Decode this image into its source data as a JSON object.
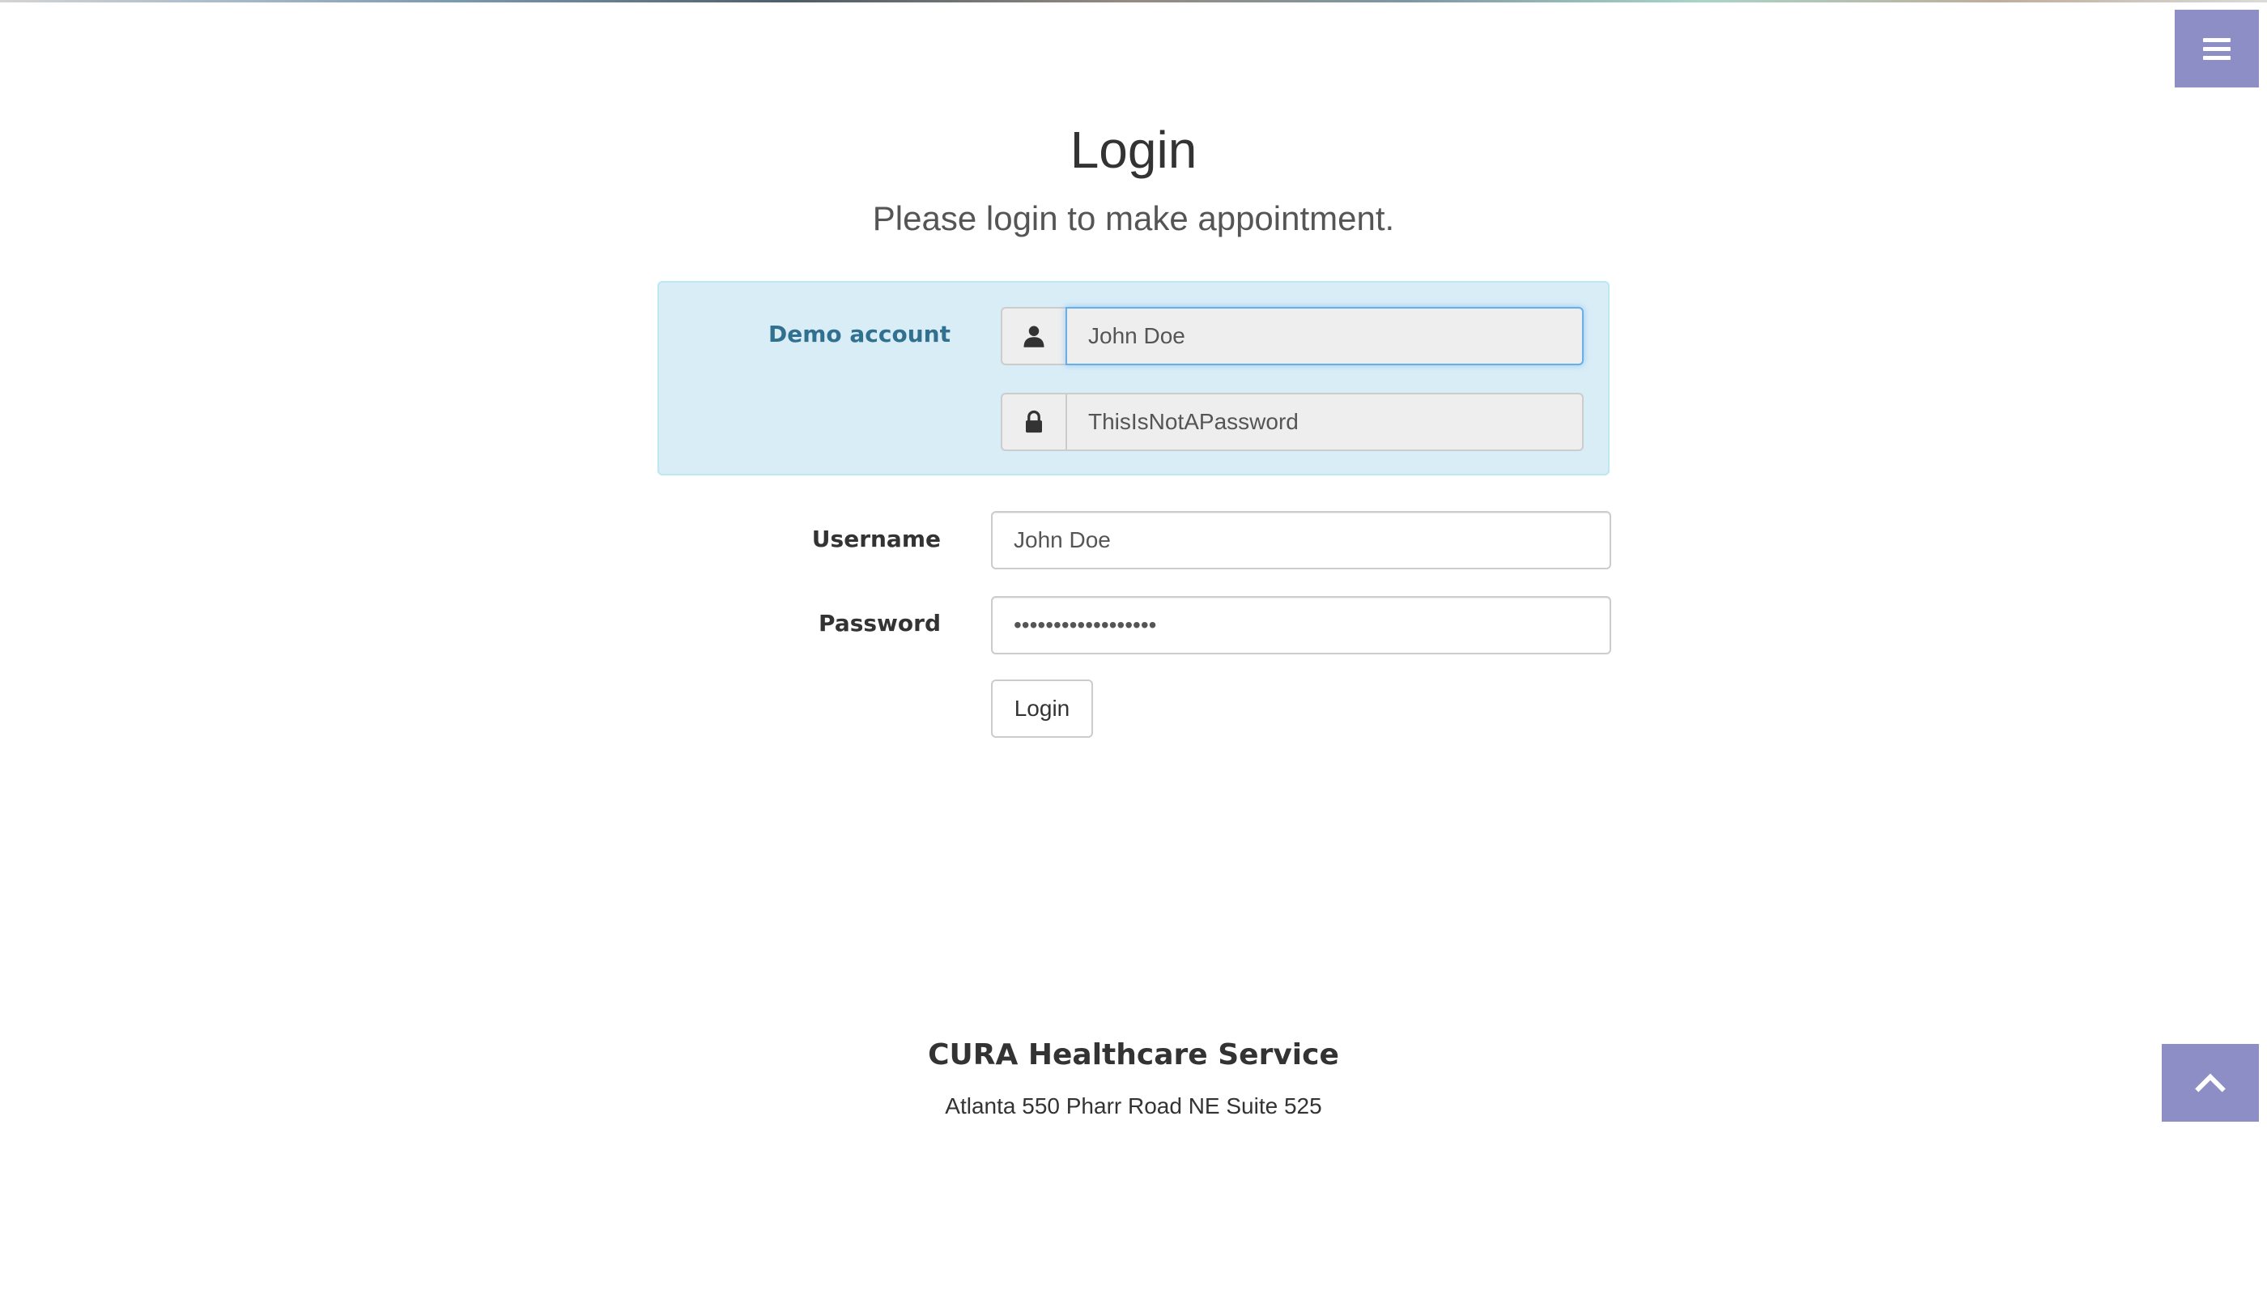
{
  "header": {
    "title": "Login",
    "subtitle": "Please login to make appointment."
  },
  "demo_account": {
    "label": "Demo account",
    "username_value": "John Doe",
    "password_value": "ThisIsNotAPassword",
    "user_icon": "user-icon",
    "lock_icon": "lock-icon"
  },
  "form": {
    "username_label": "Username",
    "username_value": "John Doe",
    "password_label": "Password",
    "password_value": "ThisIsNotAPassword",
    "login_button": "Login"
  },
  "footer": {
    "title": "CURA Healthcare Service",
    "address": "Atlanta 550 Pharr Road NE Suite 525"
  },
  "icons": {
    "menu": "hamburger-menu-icon",
    "scroll_top": "chevron-up-icon"
  },
  "colors": {
    "accent": "#8e8ec7",
    "demo_bg": "#d9edf7",
    "demo_border": "#bce8f1",
    "demo_label": "#31708f",
    "focus_border": "#66afe9"
  }
}
